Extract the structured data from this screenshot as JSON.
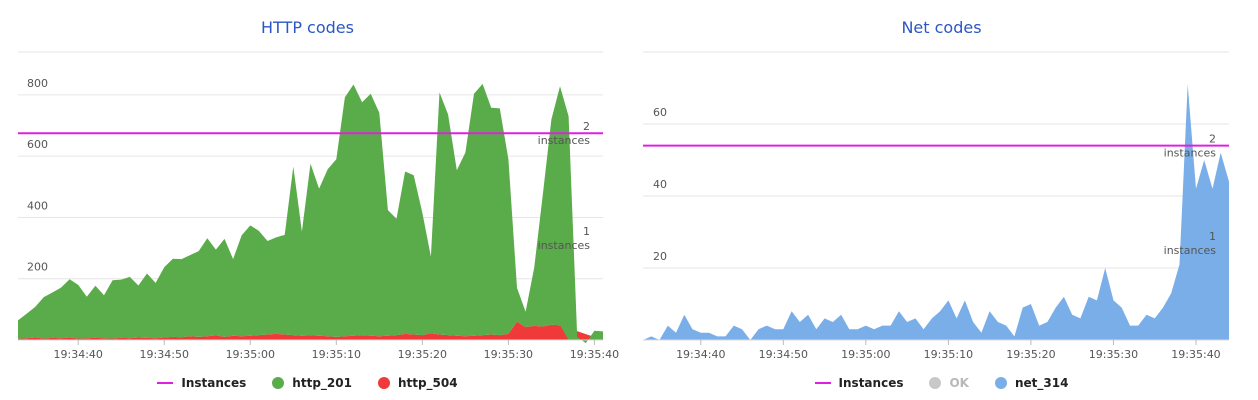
{
  "charts": [
    {
      "title": "HTTP codes",
      "legend": [
        {
          "label": "Instances",
          "color": "#e020e0",
          "marker": "line",
          "enabled": true
        },
        {
          "label": "http_201",
          "color": "#5aab4a",
          "marker": "dot",
          "enabled": true
        },
        {
          "label": "http_504",
          "color": "#f03a3a",
          "marker": "dot",
          "enabled": true
        }
      ]
    },
    {
      "title": "Net codes",
      "legend": [
        {
          "label": "Instances",
          "color": "#e020e0",
          "marker": "line",
          "enabled": true
        },
        {
          "label": "OK",
          "color": "#c8c8c8",
          "marker": "dot",
          "enabled": false
        },
        {
          "label": "net_314",
          "color": "#7aaee8",
          "marker": "dot",
          "enabled": true
        }
      ]
    }
  ],
  "chart_data": [
    {
      "type": "area",
      "title": "HTTP codes",
      "xlabel": "",
      "ylabel": "",
      "x_start": "19:34:33",
      "x_step_seconds": 1,
      "x_ticks": [
        "19:34:40",
        "19:34:50",
        "19:35:00",
        "19:35:10",
        "19:35:20",
        "19:35:30",
        "19:35:40"
      ],
      "y_ticks": [
        200,
        400,
        600,
        800
      ],
      "ylim": [
        0,
        940
      ],
      "grid": true,
      "stacked": true,
      "series": [
        {
          "name": "http_504",
          "color": "#f03a3a",
          "values": [
            4,
            6,
            8,
            5,
            7,
            6,
            8,
            5,
            6,
            7,
            6,
            5,
            7,
            6,
            8,
            7,
            6,
            8,
            10,
            9,
            12,
            10,
            12,
            15,
            10,
            14,
            12,
            14,
            16,
            18,
            20,
            18,
            16,
            14,
            15,
            14,
            12,
            10,
            12,
            14,
            16,
            14,
            12,
            14,
            16,
            20,
            18,
            16,
            22,
            18,
            16,
            14,
            12,
            14,
            16,
            18,
            16,
            20,
            60,
            42,
            46,
            44,
            50,
            48
          ]
        },
        {
          "name": "http_201",
          "color": "#5aab4a",
          "values": [
            60,
            80,
            100,
            135,
            148,
            165,
            190,
            175,
            135,
            170,
            140,
            190,
            190,
            200,
            170,
            210,
            180,
            230,
            255,
            255,
            265,
            280,
            320,
            280,
            320,
            250,
            330,
            360,
            340,
            305,
            315,
            325,
            550,
            340,
            560,
            480,
            545,
            580,
            780,
            820,
            760,
            790,
            730,
            410,
            380,
            530,
            520,
            400,
            250,
            790,
            720,
            540,
            600,
            790,
            820,
            740,
            740,
            570,
            110,
            50,
            190,
            430,
            670,
            780,
            730,
            10,
            -10,
            30,
            28
          ]
        }
      ],
      "annotations": [
        {
          "y": 675,
          "label_value": "2",
          "label_unit": "instances"
        },
        {
          "y": 333,
          "label_value": "1",
          "label_unit": "instances"
        }
      ]
    },
    {
      "type": "area",
      "title": "Net codes",
      "xlabel": "",
      "ylabel": "",
      "x_start": "19:34:33",
      "x_step_seconds": 1,
      "x_ticks": [
        "19:34:40",
        "19:34:50",
        "19:35:00",
        "19:35:10",
        "19:35:20",
        "19:35:30",
        "19:35:40"
      ],
      "y_ticks": [
        20,
        40,
        60
      ],
      "ylim": [
        0,
        80
      ],
      "grid": true,
      "stacked": false,
      "series": [
        {
          "name": "net_314",
          "color": "#7aaee8",
          "values": [
            0,
            1,
            0,
            4,
            2,
            7,
            3,
            2,
            2,
            1,
            1,
            4,
            3,
            0,
            3,
            4,
            3,
            3,
            8,
            5,
            7,
            3,
            6,
            5,
            7,
            3,
            3,
            4,
            3,
            4,
            4,
            8,
            5,
            6,
            3,
            6,
            8,
            11,
            6,
            11,
            5,
            2,
            8,
            5,
            4,
            1,
            9,
            10,
            4,
            5,
            9,
            12,
            7,
            6,
            12,
            11,
            20,
            11,
            9,
            4,
            4,
            7,
            6,
            9,
            13,
            21,
            71,
            42,
            50,
            42,
            52,
            44
          ]
        }
      ],
      "annotations": [
        {
          "y": 54,
          "label_value": "2",
          "label_unit": "instances"
        },
        {
          "y": 27,
          "label_value": "1",
          "label_unit": "instances"
        }
      ]
    }
  ]
}
